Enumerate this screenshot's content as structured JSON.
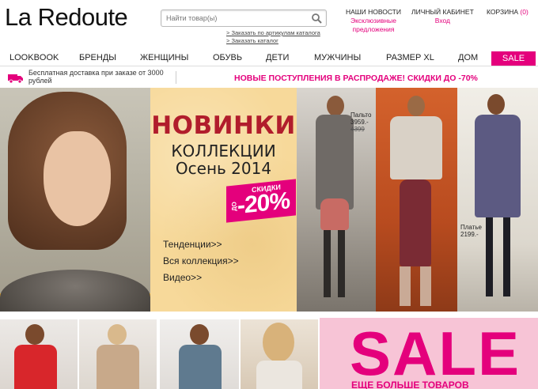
{
  "header": {
    "logo": "La Redoute",
    "search": {
      "placeholder": "Найти товар(ы)"
    },
    "sub_links": [
      "Заказать по артикулам каталога",
      "Заказать каталог"
    ],
    "top_menu": [
      {
        "title": "НАШИ НОВОСТИ",
        "sub1": "Эксклюзивные",
        "sub2": "предложения"
      },
      {
        "title": "ЛИЧНЫЙ КАБИНЕТ",
        "sub1": "Вход",
        "sub2": ""
      },
      {
        "title": "КОРЗИНА",
        "count": "(0)"
      }
    ]
  },
  "nav": {
    "items": [
      "LOOKBOOK",
      "БРЕНДЫ",
      "ЖЕНЩИНЫ",
      "ОБУВЬ",
      "ДЕТИ",
      "МУЖЧИНЫ",
      "РАЗМЕР XL",
      "ДОМ"
    ],
    "sale": "SALE"
  },
  "promo": {
    "shipping": "Бесплатная доставка при заказе от 3000 рублей",
    "headline": "НОВЫЕ ПОСТУПЛЕНИЯ В РАСПРОДАЖЕ! СКИДКИ ДО -70%"
  },
  "banner": {
    "title": "НОВИНКИ",
    "subtitle1": "КОЛЛЕКЦИИ",
    "subtitle2": "Осень 2014",
    "discount_label": "СКИДКИ",
    "discount_do": "ДО",
    "discount_value": "-20%",
    "links": [
      "Тенденции>>",
      "Вся коллекция>>",
      "Видео>>"
    ],
    "price1": {
      "name": "Пальто",
      "price": "3959.-",
      "old": "4399"
    },
    "price2": {
      "name": "Платье",
      "price": "2199.-"
    }
  },
  "bottom": {
    "sale_title": "SALE",
    "sale_sub": "ЕЩЕ БОЛЬШЕ ТОВАРОВ"
  },
  "colors": {
    "accent": "#e4007c",
    "title_red": "#b11d2c",
    "banner_bg": "#f7d99a",
    "sale_bg": "#f7c4d6"
  }
}
